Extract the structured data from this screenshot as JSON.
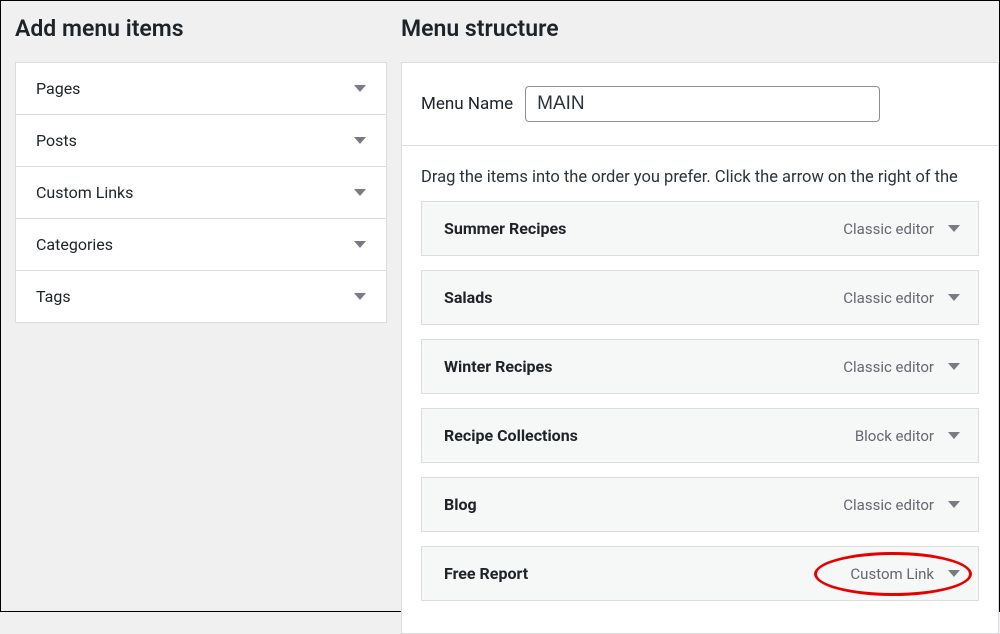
{
  "leftHeading": "Add menu items",
  "rightHeading": "Menu structure",
  "accordion": [
    "Pages",
    "Posts",
    "Custom Links",
    "Categories",
    "Tags"
  ],
  "menuNameLabel": "Menu Name",
  "menuNameValue": "MAIN",
  "instructions": "Drag the items into the order you prefer. Click the arrow on the right of the",
  "menuItems": [
    {
      "label": "Summer Recipes",
      "type": "Classic editor"
    },
    {
      "label": "Salads",
      "type": "Classic editor"
    },
    {
      "label": "Winter Recipes",
      "type": "Classic editor"
    },
    {
      "label": "Recipe Collections",
      "type": "Block editor"
    },
    {
      "label": "Blog",
      "type": "Classic editor"
    },
    {
      "label": "Free Report",
      "type": "Custom Link"
    }
  ]
}
